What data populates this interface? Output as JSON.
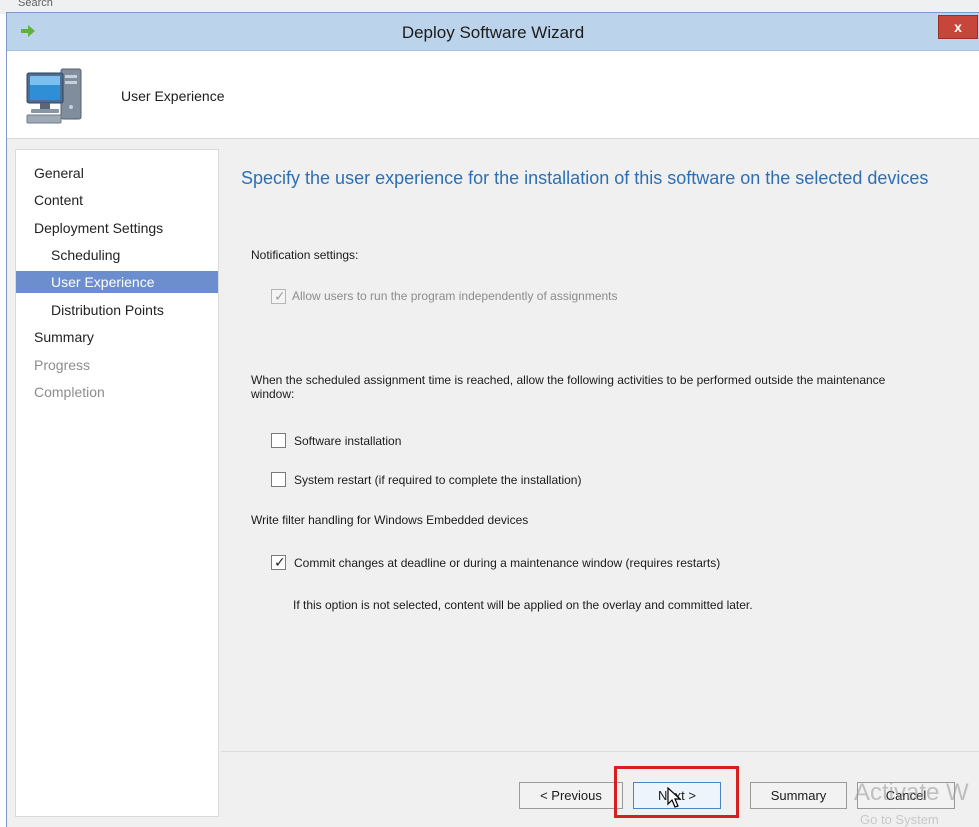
{
  "background": {
    "search_label": "Search"
  },
  "window": {
    "title": "Deploy Software Wizard",
    "close_label": "x",
    "page_title": "User Experience"
  },
  "sidebar": {
    "items": [
      {
        "label": "General",
        "state": "normal"
      },
      {
        "label": "Content",
        "state": "normal"
      },
      {
        "label": "Deployment Settings",
        "state": "normal"
      },
      {
        "label": "Scheduling",
        "state": "normal"
      },
      {
        "label": "User Experience",
        "state": "active"
      },
      {
        "label": "Distribution Points",
        "state": "normal"
      },
      {
        "label": "Summary",
        "state": "normal"
      },
      {
        "label": "Progress",
        "state": "disabled"
      },
      {
        "label": "Completion",
        "state": "disabled"
      }
    ]
  },
  "content": {
    "heading": "Specify the user experience for the installation of this software on the selected devices",
    "notification_settings_label": "Notification settings:",
    "allow_users_label": "Allow users to run the program independently of assignments",
    "allow_users_checked": true,
    "maintenance_text": "When the scheduled assignment time is reached, allow the following activities to be performed outside the maintenance window:",
    "software_installation_label": "Software installation",
    "software_installation_checked": false,
    "system_restart_label": "System restart (if required to complete the installation)",
    "system_restart_checked": false,
    "write_filter_label": "Write filter handling for Windows Embedded devices",
    "commit_changes_label": "Commit changes at deadline or during a maintenance window (requires restarts)",
    "commit_changes_checked": true,
    "overlay_note": "If this option is not selected, content will be applied on the overlay and committed later."
  },
  "footer": {
    "previous_label": "< Previous",
    "next_label": "Next >",
    "summary_label": "Summary",
    "cancel_label": "Cancel"
  },
  "overlay": {
    "watermark": "Activate W",
    "watermark_sub": "Go to System"
  },
  "colors": {
    "titlebar": "#bcd3ec",
    "heading": "#2c6fb5",
    "active_nav": "#6c8ecf",
    "highlight": "#d81f1f",
    "close_button": "#c7453a"
  }
}
